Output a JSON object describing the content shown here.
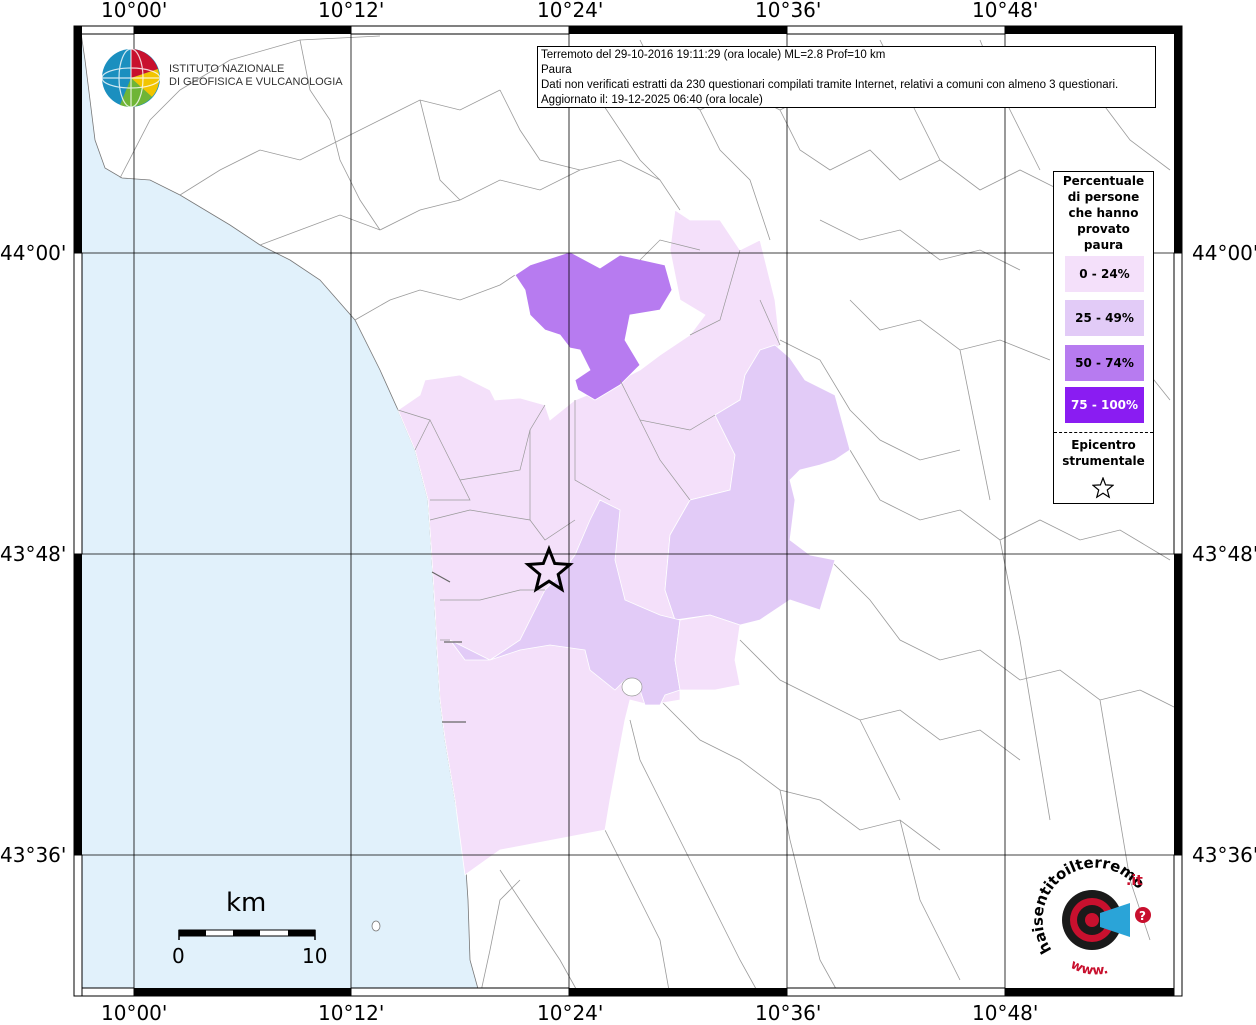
{
  "map": {
    "info": {
      "line1": "Terremoto del 29-10-2016 19:11:29 (ora locale) ML=2.8 Prof=10 km",
      "line2": "Paura",
      "line3": "Dati non verificati estratti da 230 questionari compilati tramite Internet, relativi a comuni con almeno 3 questionari.",
      "line4": "Aggiornato il: 19-12-2025 06:40 (ora locale)"
    },
    "lon_labels": [
      "10°00'",
      "10°12'",
      "10°24'",
      "10°36'",
      "10°48'"
    ],
    "lat_labels": [
      "44°00'",
      "43°48'",
      "43°36'"
    ],
    "legend": {
      "title": "Percentuale di persone che hanno provato paura",
      "title_lines": [
        "Percentuale",
        "di persone",
        "che hanno",
        "provato",
        "paura"
      ],
      "classes": [
        {
          "label": "0 - 24%",
          "color": "#f4e0fa"
        },
        {
          "label": "25 - 49%",
          "color": "#e2cbf7"
        },
        {
          "label": "50 - 74%",
          "color": "#b77bf0"
        },
        {
          "label": "75 - 100%",
          "color": "#8a1cf2"
        }
      ],
      "epicentre_title": "Epicentro strumentale",
      "epicentre_lines": [
        "Epicentro",
        "strumentale"
      ],
      "epicentre_icon": "star-icon"
    },
    "scale": {
      "unit": "km",
      "min": "0",
      "max": "10"
    },
    "institute": {
      "line1": "ISTITUTO NAZIONALE",
      "line2": "DI GEOFISICA E VULCANOLOGIA"
    },
    "hst_logo": {
      "text_main": "haisentitoilterremoto",
      "text_it": ".it",
      "text_www": "www.",
      "text_q": "?"
    },
    "colors": {
      "sea": "#e1f1fb",
      "boundary": "#999999",
      "grid": "#000000"
    }
  }
}
